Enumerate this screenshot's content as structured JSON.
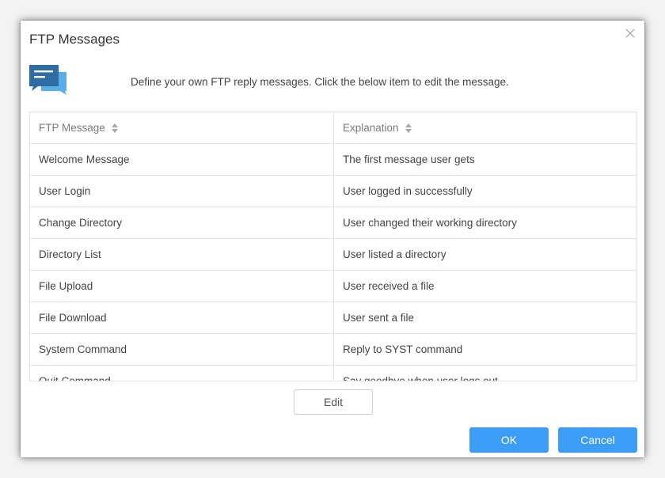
{
  "dialog": {
    "title": "FTP Messages",
    "intro": "Define your own FTP reply messages. Click the below item to edit the message."
  },
  "table": {
    "headers": [
      "FTP Message",
      "Explanation"
    ],
    "rows": [
      [
        "Welcome Message",
        "The first message user gets"
      ],
      [
        "User Login",
        "User logged in successfully"
      ],
      [
        "Change Directory",
        "User changed their working directory"
      ],
      [
        "Directory List",
        "User listed a directory"
      ],
      [
        "File Upload",
        "User received a file"
      ],
      [
        "File Download",
        "User sent a file"
      ],
      [
        "System Command",
        "Reply to SYST command"
      ],
      [
        "Quit Command",
        "Say goodbye when user logs out"
      ]
    ]
  },
  "buttons": {
    "edit": "Edit",
    "ok": "OK",
    "cancel": "Cancel"
  },
  "colors": {
    "accent": "#3b9df5",
    "icon_dark": "#2e6da4",
    "icon_light": "#5aaee8"
  },
  "icons": {
    "close": "close-icon",
    "messages": "chat-bubbles-icon",
    "sort": "sort-icon"
  }
}
